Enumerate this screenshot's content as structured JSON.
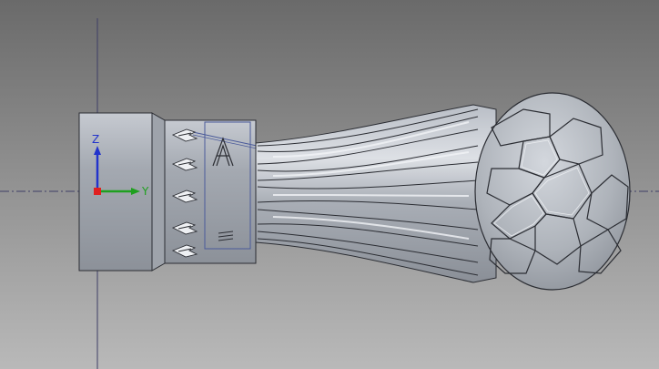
{
  "viewport": {
    "background_top": "#6a6a6a",
    "background_bottom": "#b9b9b9"
  },
  "triad": {
    "z_label": "Z",
    "y_label": "Y",
    "z_color": "#2233cc",
    "y_color": "#1fa01f",
    "origin_color": "#e02020",
    "axis_line_color": "#3a3a6a"
  },
  "model": {
    "part_color": "#a8adb5",
    "edge_color": "#2b2d33",
    "sketch_frame_color": "#4a5a9a",
    "engraved_letter": "A",
    "icons": [
      "soccer-ball-icon",
      "winged-emblem-icon"
    ]
  }
}
